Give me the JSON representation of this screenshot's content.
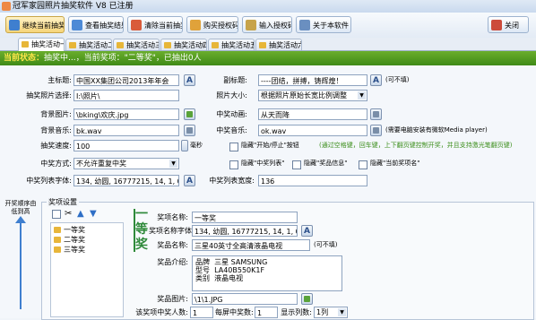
{
  "window": {
    "title": "冠军家园照片抽奖软件  V8  已注册"
  },
  "toolbar": {
    "buttons": [
      "继续当前抽奖",
      "查看抽奖结果",
      "清除当前抽奖",
      "购买授权码",
      "输入授权码",
      "关于本软件"
    ],
    "close_label": "关闭"
  },
  "tabs": [
    "抽奖活动一",
    "抽奖活动二",
    "抽奖活动三",
    "抽奖活动四",
    "抽奖活动五",
    "抽奖活动六"
  ],
  "status": {
    "label": "当前状态：",
    "text": "抽奖中...，当前奖项：\"二等奖\"，已抽出0人"
  },
  "form": {
    "main_title_label": "主标题:",
    "main_title_value": "中国XX集团公司2013年年会",
    "sub_title_label": "副标题:",
    "sub_title_value": "----团结，拼搏，铸辉煌！",
    "sub_title_note": "(可不填)",
    "photo_dir_label": "抽奖照片选择:",
    "photo_dir_value": "I:\\照片\\",
    "photo_size_label": "照片大小:",
    "photo_size_value": "根据照片原始长宽比例调整",
    "bg_image_label": "背景图片:",
    "bg_image_value": "\\bking\\欢庆.jpg",
    "anim_label": "中奖动画:",
    "anim_value": "从天而降",
    "bg_music_label": "背景音乐:",
    "bg_music_value": "bk.wav",
    "win_music_label": "中奖音乐:",
    "win_music_value": "ok.wav",
    "win_music_note": "(需要电脑安装有微软Media player)",
    "speed_label": "抽奖速度:",
    "speed_value": "100",
    "speed_unit": "毫秒",
    "hide_start_stop": "隐藏\"开始/停止\"按钮",
    "hint": "(通过空格键，回车键，上下翻页键控制开奖，并且支持激光笔翻页键)",
    "mode_label": "中奖方式:",
    "mode_value": "不允许重复中奖",
    "hide_win_list": "隐藏\"中奖列表\"",
    "hide_prize_info": "隐藏\"奖品信息\"",
    "hide_current_prize": "隐藏\"当前奖项名\"",
    "list_font_label": "中奖列表字体:",
    "list_font_value": "134, 幼圆, 16777215, 14, 1, 0, 0, 0",
    "list_width_label": "中奖列表宽度:",
    "list_width_value": "136"
  },
  "prizes": {
    "group_title": "奖项设置",
    "side_label": "开奖顺序由低到高",
    "items": [
      "一等奖",
      "二等奖",
      "三等奖"
    ],
    "big_label": "一等奖",
    "name_label": "奖项名称:",
    "name_value": "一等奖",
    "name_font_label": "奖项名称字体:",
    "name_font_value": "134, 幼圆, 16777215, 14, 1, 0, 0, 0",
    "prize_name_label": "奖品名称:",
    "prize_name_value": "三星40英寸全高清液晶电视",
    "prize_name_note": "(可不填)",
    "intro_label": "奖品介绍:",
    "intro_lines": [
      "品牌  三星 SAMSUNG",
      "型号  LA40B550K1F",
      "类别  液晶电视"
    ],
    "image_label": "奖品图片:",
    "image_value": "\\1\\1.JPG",
    "count_label": "该奖项中奖人数:",
    "count_value": "1",
    "per_label": "每屏中奖数:",
    "per_value": "1",
    "cols_label": "显示列数:",
    "cols_value": "1列"
  },
  "colors": {
    "status_bg": "#4a9a1f",
    "status_highlight": "#ffe64a",
    "accent_text": "#3b8e1b"
  }
}
